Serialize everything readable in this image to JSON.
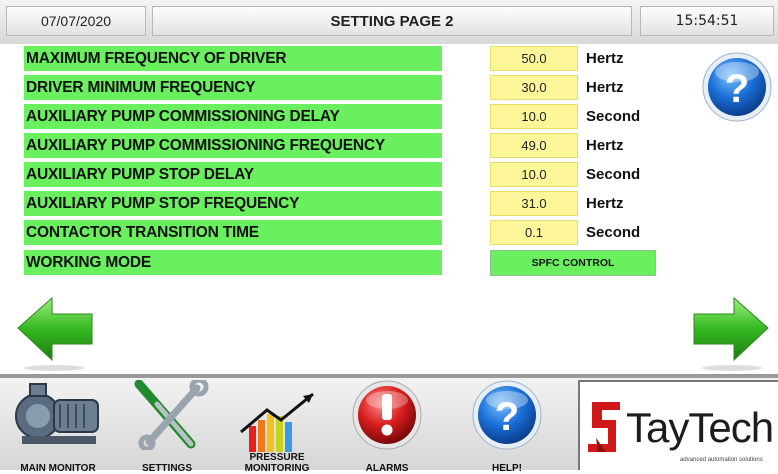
{
  "header": {
    "date": "07/07/2020",
    "title": "SETTING PAGE 2",
    "time": "15:54:51"
  },
  "parameters": [
    {
      "label": "MAXIMUM FREQUENCY OF DRIVER",
      "value": "50.0",
      "unit": "Hertz"
    },
    {
      "label": "DRIVER MINIMUM FREQUENCY",
      "value": "30.0",
      "unit": "Hertz"
    },
    {
      "label": "AUXILIARY PUMP COMMISSIONING DELAY",
      "value": "10.0",
      "unit": "Second"
    },
    {
      "label": "AUXILIARY PUMP COMMISSIONING FREQUENCY",
      "value": "49.0",
      "unit": "Hertz"
    },
    {
      "label": "AUXILIARY PUMP STOP DELAY",
      "value": "10.0",
      "unit": "Second"
    },
    {
      "label": "AUXILIARY PUMP STOP FREQUENCY",
      "value": "31.0",
      "unit": "Hertz"
    },
    {
      "label": "CONTACTOR TRANSITION TIME",
      "value": "0.1",
      "unit": "Second"
    }
  ],
  "working_mode": {
    "label": "WORKING MODE",
    "value": "SPFC CONTROL"
  },
  "bottom_nav": {
    "main_monitor": "MAIN MONITOR",
    "settings": "SETTINGS",
    "pressure_line1": "PRESSURE",
    "pressure_line2": "MONITORING",
    "alarms": "ALARMS",
    "help": "HELP!"
  },
  "logo": {
    "name": "TayTech",
    "tagline": "advanced automation solutions"
  },
  "colors": {
    "label_bg": "#6af05f",
    "value_bg": "#fdf79a",
    "help_blue": "#1a6fd6",
    "alarm_red": "#d81c1c",
    "arrow_green": "#34b820"
  },
  "icons": [
    "help-icon",
    "back-arrow-icon",
    "forward-arrow-icon",
    "pump-icon",
    "settings-tools-icon",
    "pressure-chart-icon",
    "alarm-icon",
    "help-icon",
    "taytech-logo-icon"
  ]
}
